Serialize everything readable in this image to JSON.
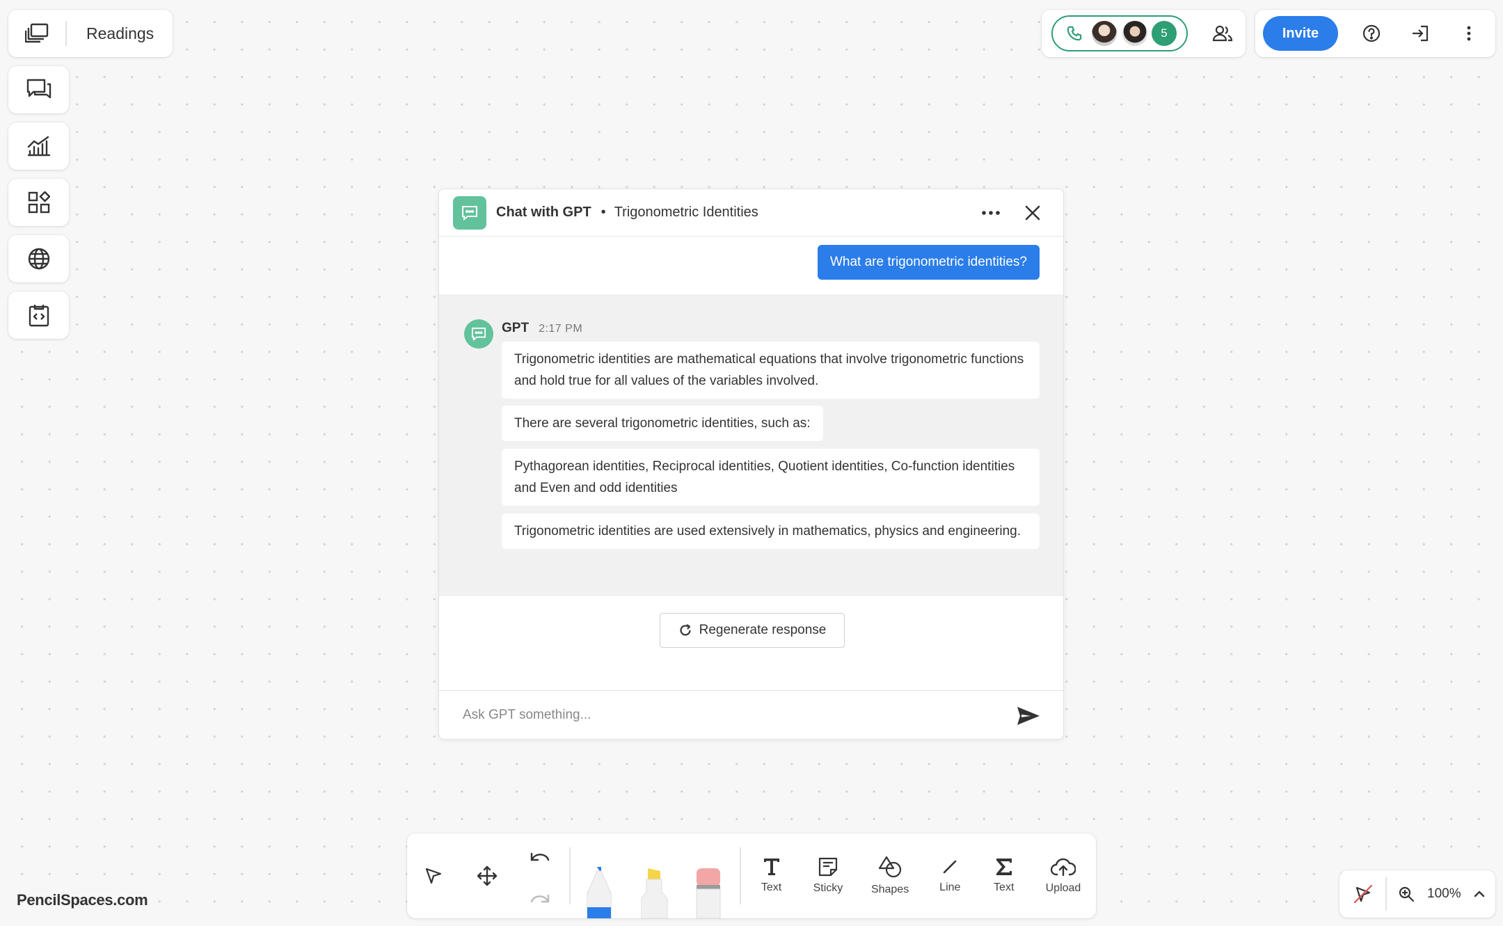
{
  "board": {
    "title": "Readings"
  },
  "sidebar": {
    "items": [
      {
        "name": "chat",
        "icon": "chat-bubbles-icon"
      },
      {
        "name": "analytics",
        "icon": "line-chart-icon"
      },
      {
        "name": "apps",
        "icon": "apps-grid-icon"
      },
      {
        "name": "web",
        "icon": "globe-icon"
      },
      {
        "name": "embed",
        "icon": "code-embed-icon"
      }
    ]
  },
  "presence": {
    "count": "5",
    "call_icon": "phone-icon",
    "accent": "#2e9e74"
  },
  "actions": {
    "invite_label": "Invite",
    "accent": "#2b7de9"
  },
  "chat": {
    "title": "Chat with GPT",
    "separator": "•",
    "topic": "Trigonometric Identities",
    "user_message": "What are trigonometric identities?",
    "gpt_name": "GPT",
    "gpt_time": "2:17 PM",
    "messages": [
      "Trigonometric identities are mathematical equations that involve trigonometric functions and hold true for all values of the variables involved.",
      "There are several trigonometric identities, such as:",
      "Pythagorean identities, Reciprocal identities, Quotient identities, Co-function identities and Even and odd identities",
      "Trigonometric identities are used extensively in mathematics, physics and engineering."
    ],
    "regenerate_label": "Regenerate response",
    "input_placeholder": "Ask GPT something...",
    "bot_color": "#62c29b"
  },
  "toolbar": {
    "text_label": "Text",
    "sticky_label": "Sticky",
    "shapes_label": "Shapes",
    "line_label": "Line",
    "math_label": "Text",
    "upload_label": "Upload",
    "pen_color": "#2b7de9",
    "highlighter_color": "#f5d54a",
    "eraser_color": "#f2a6a6"
  },
  "brand": "PencilSpaces.com",
  "zoom": {
    "level": "100%"
  }
}
